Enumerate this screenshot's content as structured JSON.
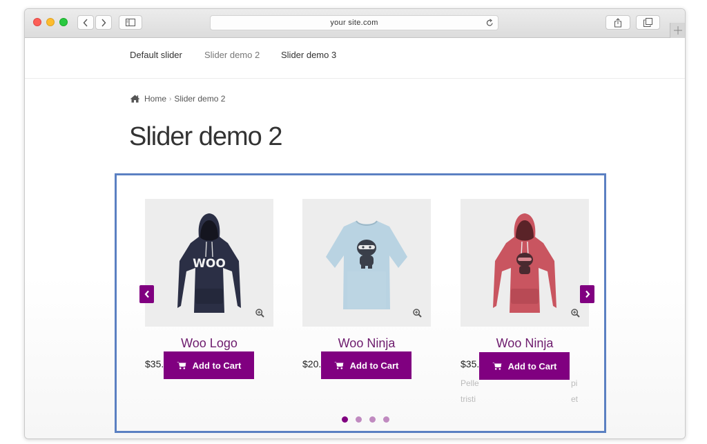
{
  "browser": {
    "url": "your site.com"
  },
  "nav": {
    "items": [
      {
        "label": "Default slider"
      },
      {
        "label": "Slider demo 2"
      },
      {
        "label": "Slider demo 3"
      }
    ]
  },
  "breadcrumb": {
    "home": "Home",
    "current": "Slider demo 2"
  },
  "page": {
    "title": "Slider demo 2"
  },
  "products": [
    {
      "name": "Woo Logo",
      "price": "$35.00",
      "button": "Add to Cart",
      "garment": "hoodie",
      "color": "#2b2f45",
      "print": "WOO"
    },
    {
      "name": "Woo Ninja",
      "price": "$20.00",
      "button": "Add to Cart",
      "garment": "tshirt",
      "color": "#b9d3e2",
      "print": "ninja"
    },
    {
      "name": "Woo Ninja",
      "price": "$35.00",
      "button": "Add to Cart",
      "garment": "hoodie",
      "color": "#c95560",
      "print": "ninja"
    }
  ],
  "ghost_text": {
    "line1a": "Pelle",
    "line1b": "pi",
    "line2a": "tristi",
    "line2b": "et"
  },
  "slider": {
    "dots": 4,
    "active_dot": 0
  },
  "colors": {
    "accent": "#800080",
    "product_title": "#6d1b6d",
    "slider_border": "#5b80c2"
  }
}
